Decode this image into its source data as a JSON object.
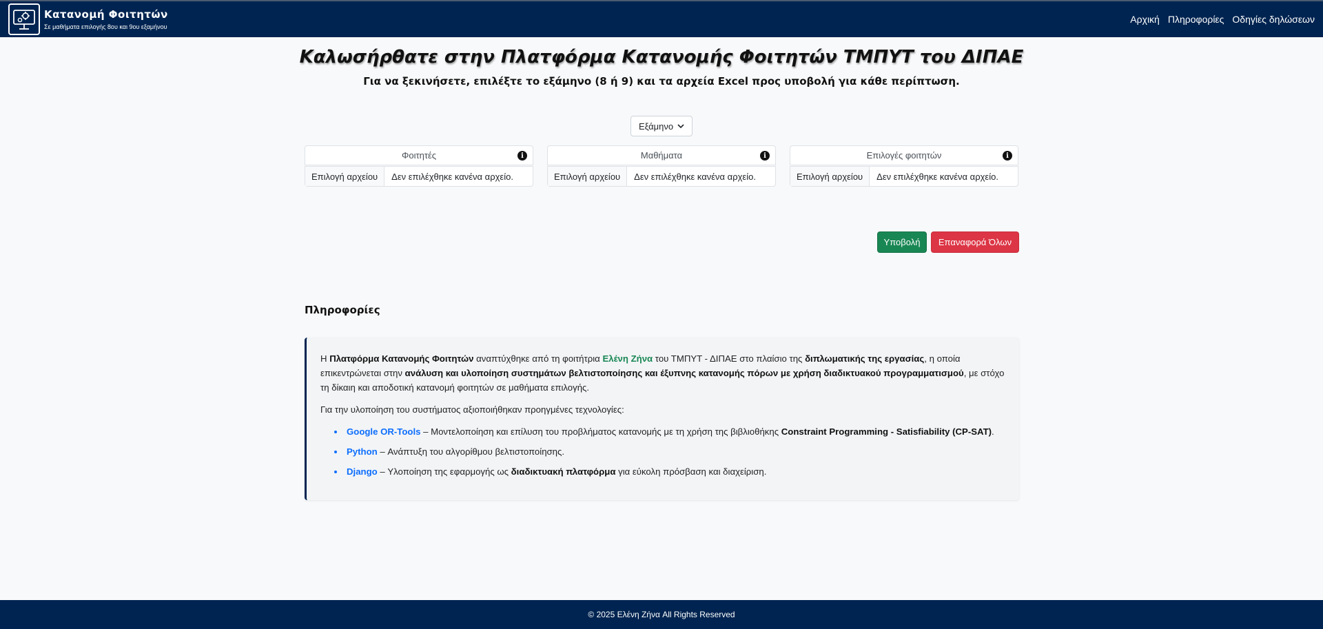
{
  "navbar": {
    "title": "Κατανομή Φοιτητών",
    "subtitle": "Σε μαθήματα επιλογής 8ου και 9ου εξαμήνου",
    "links": [
      "Αρχική",
      "Πληροφορίες",
      "Οδηγίες δηλώσεων"
    ]
  },
  "main": {
    "title": "Καλωσήρθατε στην Πλατφόρμα Κατανομής Φοιτητών ΤΜΠΥΤ του ΔΙΠΑΕ",
    "subtitle": "Για να ξεκινήσετε, επιλέξτε το εξάμηνο (8 ή 9) και τα αρχεία Excel προς υποβολή για κάθε περίπτωση.",
    "semester_select": "Εξάμηνο",
    "uploads": [
      {
        "label": "Φοιτητές",
        "button": "Επιλογή αρχείου",
        "status": "Δεν επιλέχθηκε κανένα αρχείο."
      },
      {
        "label": "Μαθήματα",
        "button": "Επιλογή αρχείου",
        "status": "Δεν επιλέχθηκε κανένα αρχείο."
      },
      {
        "label": "Επιλογές φοιτητών",
        "button": "Επιλογή αρχείου",
        "status": "Δεν επιλέχθηκε κανένα αρχείο."
      }
    ],
    "submit_label": "Υποβολή",
    "reset_label": "Επαναφορά Όλων"
  },
  "info": {
    "heading": "Πληροφορίες",
    "p1": {
      "t1": "Η ",
      "b1": "Πλατφόρμα Κατανομής Φοιτητών",
      "t2": " αναπτύχθηκε από τη φοιτήτρια ",
      "name": "Ελένη Ζήνα",
      "t3": " του ΤΜΠΥΤ - ΔΙΠΑΕ στο πλαίσιο της ",
      "b2": "διπλωματικής της εργασίας",
      "t4": ", η οποία επικεντρώνεται στην ",
      "b3": "ανάλυση και υλοποίηση συστημάτων βελτιστοποίησης και έξυπνης κατανομής πόρων με χρήση διαδικτυακού προγραμματισμού",
      "t5": ", με στόχο τη δίκαιη και αποδοτική κατανομή φοιτητών σε μαθήματα επιλογής."
    },
    "p2": "Για την υλοποίηση του συστήματος αξιοποιήθηκαν προηγμένες τεχνολογίες:",
    "tech": [
      {
        "name": "Google OR-Tools",
        "t1": " – Μοντελοποίηση και επίλυση του προβλήματος κατανομής με τη χρήση της βιβλιοθήκης ",
        "b": "Constraint Programming - Satisfiability (CP-SAT)",
        "t2": "."
      },
      {
        "name": "Python",
        "t1": " – Ανάπτυξη του αλγορίθμου βελτιστοποίησης.",
        "b": "",
        "t2": ""
      },
      {
        "name": "Django",
        "t1": " – Υλοποίηση της εφαρμογής ως ",
        "b": "διαδικτυακή πλατφόρμα",
        "t2": " για εύκολη πρόσβαση και διαχείριση."
      }
    ]
  },
  "footer": {
    "text": "© 2025 Ελένη Ζήνα All Rights Reserved"
  },
  "colors": {
    "navbar": "#002451",
    "submit": "#198754",
    "reset": "#dc3545",
    "link": "#0d6efd"
  }
}
